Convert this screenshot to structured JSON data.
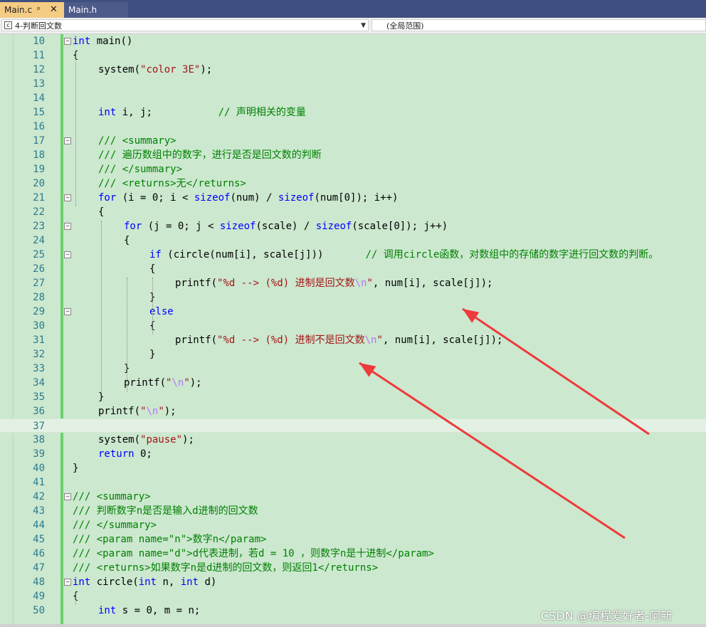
{
  "tabs": [
    {
      "label": "Main.c",
      "pin": "ᵖ",
      "close": "✕",
      "active": true
    },
    {
      "label": "Main.h",
      "active": false
    }
  ],
  "nav": {
    "project": "4-判断回文数",
    "scope": "(全局范围)"
  },
  "watermark": "CSDN @编程爱好者-阿新",
  "colors": {
    "background": "#cce8cf",
    "keyword": "#0000ff",
    "string": "#a31515",
    "comment": "#008000",
    "arrow": "#ee3a3a"
  },
  "lines": [
    {
      "n": "10",
      "fold": true,
      "indent": 0,
      "tokens": [
        [
          "int",
          "kw"
        ],
        [
          " main()",
          ""
        ]
      ]
    },
    {
      "n": "11",
      "indent": 0,
      "tokens": [
        [
          "{",
          ""
        ]
      ]
    },
    {
      "n": "12",
      "indent": 4,
      "tokens": [
        [
          "system(",
          ""
        ],
        [
          "\"color 3E\"",
          "str"
        ],
        [
          ");",
          ""
        ]
      ]
    },
    {
      "n": "13",
      "indent": 0,
      "tokens": []
    },
    {
      "n": "14",
      "indent": 0,
      "tokens": []
    },
    {
      "n": "15",
      "indent": 4,
      "tokens": [
        [
          "int",
          "kw"
        ],
        [
          " i, j;           ",
          ""
        ],
        [
          "// 声明相关的变量",
          "cm"
        ]
      ]
    },
    {
      "n": "16",
      "indent": 0,
      "tokens": []
    },
    {
      "n": "17",
      "fold": true,
      "indent": 4,
      "tokens": [
        [
          "/// <summary>",
          "cm"
        ]
      ]
    },
    {
      "n": "18",
      "indent": 4,
      "tokens": [
        [
          "/// 遍历数组中的数字，进行是否是回文数的判断",
          "cm"
        ]
      ]
    },
    {
      "n": "19",
      "indent": 4,
      "tokens": [
        [
          "/// </summary>",
          "cm"
        ]
      ]
    },
    {
      "n": "20",
      "indent": 4,
      "tokens": [
        [
          "/// <returns>无</returns>",
          "cm"
        ]
      ]
    },
    {
      "n": "21",
      "fold": true,
      "indent": 4,
      "tokens": [
        [
          "for",
          "kw"
        ],
        [
          " (i = 0; i < ",
          ""
        ],
        [
          "sizeof",
          "kw"
        ],
        [
          "(num) / ",
          ""
        ],
        [
          "sizeof",
          "kw"
        ],
        [
          "(num[0]); i++)",
          ""
        ]
      ]
    },
    {
      "n": "22",
      "indent": 4,
      "tokens": [
        [
          "{",
          ""
        ]
      ]
    },
    {
      "n": "23",
      "fold": true,
      "indent": 8,
      "tokens": [
        [
          "for",
          "kw"
        ],
        [
          " (j = 0; j < ",
          ""
        ],
        [
          "sizeof",
          "kw"
        ],
        [
          "(scale) / ",
          ""
        ],
        [
          "sizeof",
          "kw"
        ],
        [
          "(scale[0]); j++)",
          ""
        ]
      ]
    },
    {
      "n": "24",
      "indent": 8,
      "tokens": [
        [
          "{",
          ""
        ]
      ]
    },
    {
      "n": "25",
      "fold": true,
      "indent": 12,
      "tokens": [
        [
          "if",
          "kw"
        ],
        [
          " (circle(num[i], scale[j]))       ",
          ""
        ],
        [
          "// 调用circle函数，对数组中的存储的数字进行回文数的判断。",
          "cm"
        ]
      ]
    },
    {
      "n": "26",
      "indent": 12,
      "tokens": [
        [
          "{",
          ""
        ]
      ]
    },
    {
      "n": "27",
      "indent": 16,
      "tokens": [
        [
          "printf(",
          ""
        ],
        [
          "\"%d --> (%d) 进制是回文数",
          "str"
        ],
        [
          "\\n",
          "esc"
        ],
        [
          "\"",
          "str"
        ],
        [
          ", num[i], scale[j]);",
          ""
        ]
      ]
    },
    {
      "n": "28",
      "indent": 12,
      "tokens": [
        [
          "}",
          ""
        ]
      ]
    },
    {
      "n": "29",
      "fold": true,
      "indent": 12,
      "tokens": [
        [
          "else",
          "kw"
        ]
      ]
    },
    {
      "n": "30",
      "indent": 12,
      "tokens": [
        [
          "{",
          ""
        ]
      ]
    },
    {
      "n": "31",
      "indent": 16,
      "tokens": [
        [
          "printf(",
          ""
        ],
        [
          "\"%d --> (%d) 进制不是回文数",
          "str"
        ],
        [
          "\\n",
          "esc"
        ],
        [
          "\"",
          "str"
        ],
        [
          ", num[i], scale[j]);",
          ""
        ]
      ]
    },
    {
      "n": "32",
      "indent": 12,
      "tokens": [
        [
          "}",
          ""
        ]
      ]
    },
    {
      "n": "33",
      "indent": 8,
      "tokens": [
        [
          "}",
          ""
        ]
      ]
    },
    {
      "n": "34",
      "indent": 8,
      "tokens": [
        [
          "printf(",
          ""
        ],
        [
          "\"",
          "str"
        ],
        [
          "\\n",
          "esc"
        ],
        [
          "\"",
          "str"
        ],
        [
          ");",
          ""
        ]
      ]
    },
    {
      "n": "35",
      "indent": 4,
      "tokens": [
        [
          "}",
          ""
        ]
      ]
    },
    {
      "n": "36",
      "indent": 4,
      "tokens": [
        [
          "printf(",
          ""
        ],
        [
          "\"",
          "str"
        ],
        [
          "\\n",
          "esc"
        ],
        [
          "\"",
          "str"
        ],
        [
          ");",
          ""
        ]
      ]
    },
    {
      "n": "37",
      "indent": 0,
      "current": true,
      "tokens": []
    },
    {
      "n": "38",
      "indent": 4,
      "tokens": [
        [
          "system(",
          ""
        ],
        [
          "\"pause\"",
          "str"
        ],
        [
          ");",
          ""
        ]
      ]
    },
    {
      "n": "39",
      "indent": 4,
      "tokens": [
        [
          "return",
          "kw"
        ],
        [
          " 0;",
          ""
        ]
      ]
    },
    {
      "n": "40",
      "indent": 0,
      "tokens": [
        [
          "}",
          ""
        ]
      ]
    },
    {
      "n": "41",
      "indent": 0,
      "tokens": []
    },
    {
      "n": "42",
      "fold": true,
      "indent": 0,
      "tokens": [
        [
          "/// <summary>",
          "cm"
        ]
      ]
    },
    {
      "n": "43",
      "indent": 0,
      "tokens": [
        [
          "/// 判断数字n是否是输入d进制的回文数",
          "cm"
        ]
      ]
    },
    {
      "n": "44",
      "indent": 0,
      "tokens": [
        [
          "/// </summary>",
          "cm"
        ]
      ]
    },
    {
      "n": "45",
      "indent": 0,
      "tokens": [
        [
          "/// <param name=\"n\">数字n</param>",
          "cm"
        ]
      ]
    },
    {
      "n": "46",
      "indent": 0,
      "tokens": [
        [
          "/// <param name=\"d\">d代表进制，若d = 10 ，则数字n是十进制</param>",
          "cm"
        ]
      ]
    },
    {
      "n": "47",
      "indent": 0,
      "tokens": [
        [
          "/// <returns>如果数字n是d进制的回文数，则返回1</returns>",
          "cm"
        ]
      ]
    },
    {
      "n": "48",
      "fold": true,
      "indent": 0,
      "tokens": [
        [
          "int",
          "kw"
        ],
        [
          " circle(",
          ""
        ],
        [
          "int",
          "kw"
        ],
        [
          " n, ",
          ""
        ],
        [
          "int",
          "kw"
        ],
        [
          " d)",
          ""
        ]
      ]
    },
    {
      "n": "49",
      "indent": 0,
      "tokens": [
        [
          "{",
          ""
        ]
      ]
    },
    {
      "n": "50",
      "indent": 4,
      "tokens": [
        [
          "int",
          "kw"
        ],
        [
          " s = 0, m = n;",
          ""
        ]
      ]
    }
  ]
}
